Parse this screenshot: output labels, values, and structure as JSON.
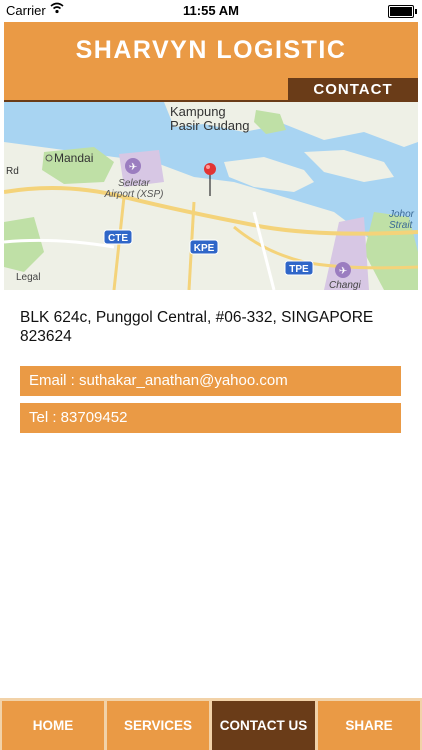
{
  "status_bar": {
    "carrier": "Carrier",
    "time": "11:55 AM"
  },
  "header": {
    "title": "SHARVYN LOGISTIC",
    "section_label": "CONTACT"
  },
  "map": {
    "labels": {
      "kampung": "Kampung",
      "pasir_gudang": "Pasir Gudang",
      "mandai": "Mandai",
      "rd": "Rd",
      "seletar_airport": "Seletar",
      "seletar_xsp": "Airport (XSP)",
      "johor": "Johor",
      "strait": "Strait",
      "legal": "Legal",
      "changi": "Changi"
    },
    "shields": {
      "cte": "CTE",
      "kpe": "KPE",
      "tpe": "TPE"
    }
  },
  "contact": {
    "address": "BLK 624c,  Punggol Central, #06-332, SINGAPORE 823624",
    "email": "Email : suthakar_anathan@yahoo.com",
    "tel": "Tel : 83709452"
  },
  "tabbar": {
    "home": "HOME",
    "services": "SERVICES",
    "contact": "CONTACT US",
    "share": "SHARE"
  },
  "colors": {
    "accent": "#ea9a45",
    "dark": "#6a3c18",
    "water": "#a8d4f2",
    "park": "#bfe0a6"
  }
}
